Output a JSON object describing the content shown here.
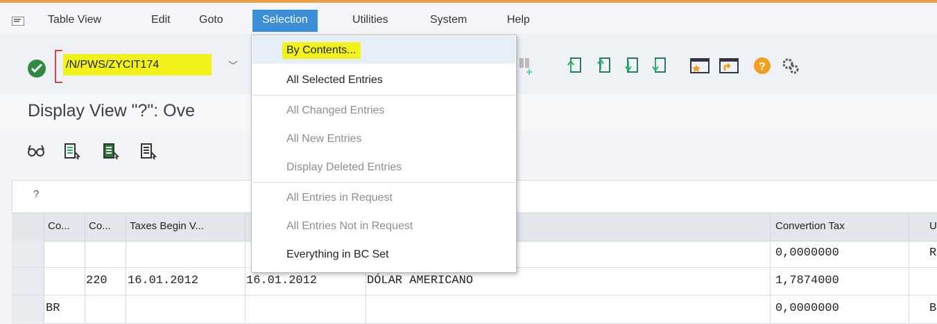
{
  "colors": {
    "accent": "#3a8fd6",
    "highlight": "#f2f21a",
    "ok": "#2e8a3e",
    "bracket": "#d6453a"
  },
  "menubar": {
    "items": [
      "Table View",
      "Edit",
      "Goto",
      "Selection",
      "Utilities",
      "System",
      "Help"
    ],
    "active": "Selection"
  },
  "toolbar": {
    "command": "/N/PWS/ZYCIT174",
    "icons": [
      "find-next-icon",
      "first-page-icon",
      "previous-page-icon",
      "next-page-icon",
      "last-page-icon",
      "create-session-icon",
      "generate-shortcut-icon",
      "help-icon",
      "customize-layout-icon"
    ]
  },
  "page": {
    "title": "Display View \"?\": Ove"
  },
  "app_icons": [
    "glasses-icon",
    "select-all-icon",
    "select-block-icon",
    "deselect-all-icon"
  ],
  "table": {
    "panel_label": "?",
    "columns": [
      "Co...",
      "Co...",
      "Taxes Begin V...",
      "",
      "",
      "Convertion Tax",
      "U"
    ],
    "rows": [
      {
        "c1": "",
        "c2": "",
        "c3": "",
        "c4": "",
        "c5": "",
        "tax": "0,0000000",
        "u": "R"
      },
      {
        "c1": "",
        "c2": "220",
        "c3": "16.01.2012",
        "c4": "16.01.2012",
        "c5": "DÓLAR AMERICANO",
        "tax": "1,7874000",
        "u": ""
      },
      {
        "c1": "BR",
        "c2": "",
        "c3": "",
        "c4": "",
        "c5": "",
        "tax": "0,0000000",
        "u": "B"
      }
    ]
  },
  "selection_menu": {
    "items": [
      {
        "label": "By Contents...",
        "enabled": true
      },
      {
        "label": "All Selected Entries",
        "enabled": true
      },
      {
        "label": "All Changed Entries",
        "enabled": false
      },
      {
        "label": "All New Entries",
        "enabled": false
      },
      {
        "label": "Display Deleted Entries",
        "enabled": false
      },
      {
        "label": "All Entries in Request",
        "enabled": false
      },
      {
        "label": "All Entries Not in Request",
        "enabled": false
      },
      {
        "label": "Everything in BC Set",
        "enabled": true
      }
    ]
  }
}
